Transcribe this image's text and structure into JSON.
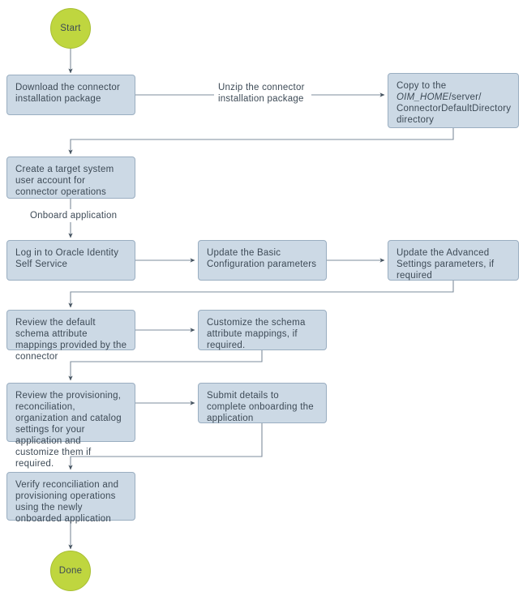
{
  "diagram": {
    "title": "Connector deployment and application onboarding flow",
    "colors": {
      "box_fill": "#ccd9e5",
      "box_border": "#9aaec1",
      "terminator_fill": "#bfd63f",
      "terminator_border": "#a8bf33",
      "text": "#3d4a56",
      "edge": "#5b6b7a",
      "background": "#ffffff"
    },
    "nodes": {
      "start": {
        "label": "Start",
        "shape": "circle"
      },
      "download_package": {
        "label": "Download the connector installation package",
        "shape": "process"
      },
      "copy_to_directory": {
        "label_line1": "Copy to the",
        "label_italic": "OIM_HOME",
        "label_line2": "/server/",
        "label_line3": "ConnectorDefaultDirectory",
        "label_line4": "directory",
        "label_plain": "Copy to the OIM_HOME/server/ConnectorDefaultDirectory directory",
        "shape": "process"
      },
      "create_account": {
        "label": "Create a target system user account for connector operations",
        "shape": "process"
      },
      "login_self_service": {
        "label": "Log in to Oracle Identity Self Service",
        "shape": "process"
      },
      "update_basic_config": {
        "label": "Update the Basic Configuration parameters",
        "shape": "process"
      },
      "update_advanced_settings": {
        "label": "Update the Advanced Settings parameters, if required",
        "shape": "process"
      },
      "review_schema": {
        "label": "Review the default schema attribute mappings provided by the connector",
        "shape": "process"
      },
      "customize_schema": {
        "label": "Customize the schema attribute mappings, if required.",
        "shape": "process"
      },
      "review_settings": {
        "label": "Review the provisioning, reconciliation, organization and catalog settings for your application and customize them if required.",
        "shape": "process"
      },
      "submit_details": {
        "label": "Submit details to complete onboarding the application",
        "shape": "process"
      },
      "verify_operations": {
        "label": "Verify reconciliation and provisioning operations using the newly onboarded application",
        "shape": "process"
      },
      "done": {
        "label": "Done",
        "shape": "circle"
      }
    },
    "edge_labels": {
      "unzip": "Unzip the connector\ninstallation package",
      "onboard": "Onboard application"
    }
  }
}
